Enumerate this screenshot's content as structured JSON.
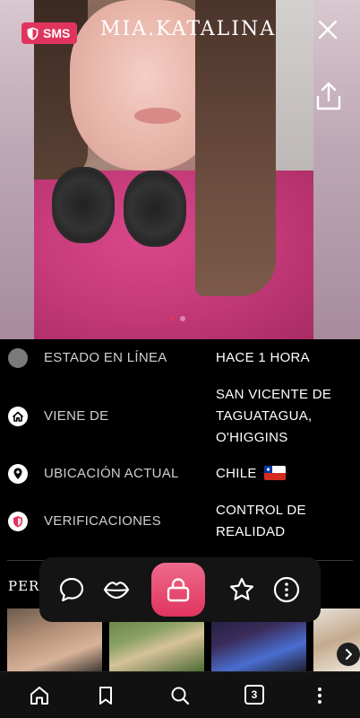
{
  "header": {
    "badge_label": "SMS",
    "username": "MIA.KATALINA"
  },
  "carousel": {
    "total": 2,
    "active_index": 0
  },
  "info_rows": [
    {
      "icon": "status-dot-icon",
      "label": "ESTADO EN LÍNEA",
      "value": [
        "HACE 1 HORA"
      ]
    },
    {
      "icon": "home-icon",
      "label": "VIENE DE",
      "value": [
        "SAN VICENTE DE",
        "TAGUATAGUA,",
        "O'HIGGINS"
      ]
    },
    {
      "icon": "location-pin-icon",
      "label": "UBICACIÓN ACTUAL",
      "value": [
        "CHILE"
      ],
      "flag": "chile-flag"
    },
    {
      "icon": "shield-icon",
      "label": "VERIFICACIONES",
      "value": [
        "CONTROL DE",
        "REALIDAD"
      ]
    }
  ],
  "section": {
    "label": "PERF"
  },
  "action_bar": {
    "items": [
      "chat-bubble-icon",
      "kiss-lips-icon",
      "lock-icon",
      "star-icon",
      "more-options-icon"
    ]
  },
  "bottom_nav": {
    "items": [
      "home-icon",
      "bookmark-icon",
      "search-icon",
      "tabs-icon",
      "more-vertical-icon"
    ],
    "tab_count": "3"
  },
  "colors": {
    "accent": "#e0345e",
    "background": "#000000",
    "status_dot": "#7a7a7a"
  }
}
